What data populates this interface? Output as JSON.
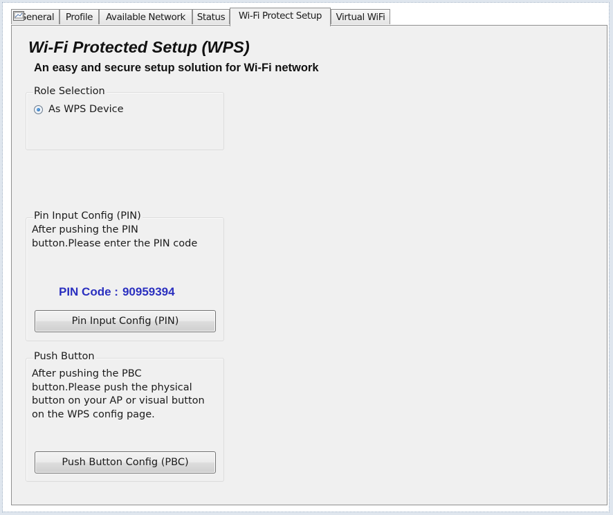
{
  "tabs": [
    {
      "label": "General",
      "active": false
    },
    {
      "label": "Profile",
      "active": false
    },
    {
      "label": "Available Network",
      "active": false
    },
    {
      "label": "Status",
      "active": false
    },
    {
      "label": "Wi-Fi Protect Setup",
      "active": true
    },
    {
      "label": "Virtual WiFi",
      "active": false
    }
  ],
  "page": {
    "title": "Wi-Fi Protected Setup (WPS)",
    "subtitle": "An easy and secure setup solution for Wi-Fi network"
  },
  "role": {
    "label": "Role Selection",
    "option": "As WPS Device",
    "selected": true
  },
  "pin": {
    "label": "Pin Input Config (PIN)",
    "line1": "After pushing the PIN",
    "line2": "button.Please enter the PIN code",
    "code_label": "PIN Code :",
    "code_value": "90959394",
    "button": "Pin Input Config (PIN)"
  },
  "pbc": {
    "label": "Push Button",
    "line1": "After pushing the PBC",
    "line2": "button.Please push the physical",
    "line3": "button on your AP or visual button",
    "line4": "on the WPS config page.",
    "button": "Push Button Config (PBC)"
  },
  "colors": {
    "pin_code": "#2a2fbf",
    "radio_selected": "#1e5fa8",
    "panel_bg": "#f0f0f0"
  }
}
